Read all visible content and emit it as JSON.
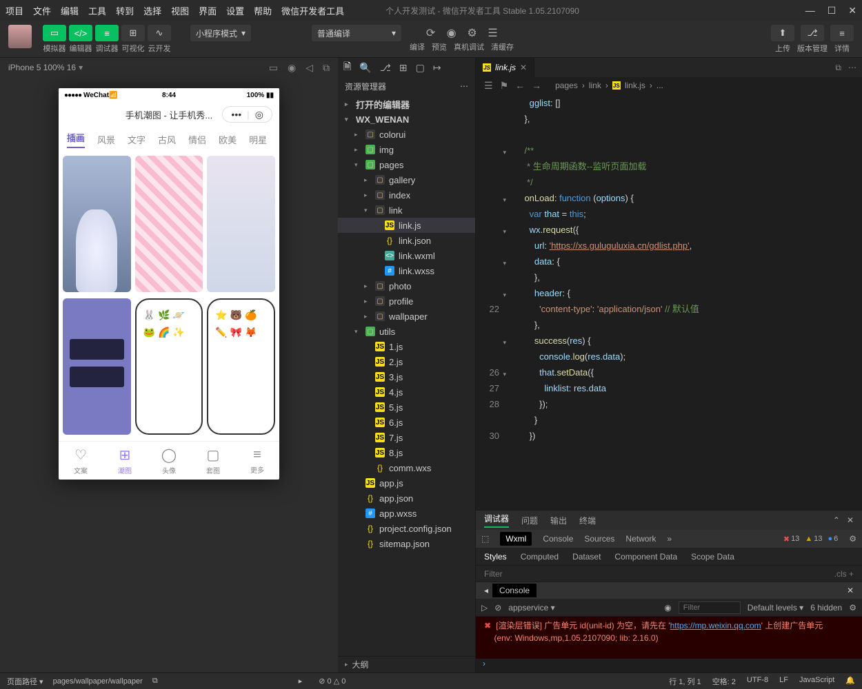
{
  "menu": [
    "项目",
    "文件",
    "编辑",
    "工具",
    "转到",
    "选择",
    "视图",
    "界面",
    "设置",
    "帮助",
    "微信开发者工具"
  ],
  "title": "个人开发测试 - 微信开发者工具 Stable 1.05.2107090",
  "toolbar": {
    "groups": [
      "模拟器",
      "编辑器",
      "调试器",
      "可视化",
      "云开发"
    ],
    "mode_select": "小程序模式",
    "compile_select": "普通编译",
    "center": [
      "编译",
      "预览",
      "真机调试",
      "清缓存"
    ],
    "right": [
      "上传",
      "版本管理",
      "详情"
    ]
  },
  "sim": {
    "device": "iPhone 5 100% 16",
    "wechat": "WeChat",
    "time": "8:44",
    "battery": "100%",
    "app_title": "手机潮图 - 让手机秀...",
    "tabs": [
      "插画",
      "风景",
      "文字",
      "古风",
      "情侣",
      "欧美",
      "明星"
    ],
    "nav": [
      "文案",
      "潮图",
      "头像",
      "套图",
      "更多"
    ]
  },
  "explorer": {
    "title": "资源管理器",
    "open_editors": "打开的编辑器",
    "project": "WX_WENAN",
    "tree": [
      {
        "d": 1,
        "t": "folder",
        "l": "colorui"
      },
      {
        "d": 1,
        "t": "folder-g",
        "l": "img"
      },
      {
        "d": 1,
        "t": "folder-g",
        "l": "pages",
        "open": true
      },
      {
        "d": 2,
        "t": "folder",
        "l": "gallery"
      },
      {
        "d": 2,
        "t": "folder",
        "l": "index"
      },
      {
        "d": 2,
        "t": "folder",
        "l": "link",
        "open": true
      },
      {
        "d": 3,
        "t": "js",
        "l": "link.js",
        "sel": true
      },
      {
        "d": 3,
        "t": "json",
        "l": "link.json"
      },
      {
        "d": 3,
        "t": "wxml",
        "l": "link.wxml"
      },
      {
        "d": 3,
        "t": "wxss",
        "l": "link.wxss"
      },
      {
        "d": 2,
        "t": "folder",
        "l": "photo"
      },
      {
        "d": 2,
        "t": "folder",
        "l": "profile"
      },
      {
        "d": 2,
        "t": "folder",
        "l": "wallpaper"
      },
      {
        "d": 1,
        "t": "folder-g",
        "l": "utils",
        "open": true
      },
      {
        "d": 2,
        "t": "js",
        "l": "1.js"
      },
      {
        "d": 2,
        "t": "js",
        "l": "2.js"
      },
      {
        "d": 2,
        "t": "js",
        "l": "3.js"
      },
      {
        "d": 2,
        "t": "js",
        "l": "4.js"
      },
      {
        "d": 2,
        "t": "js",
        "l": "5.js"
      },
      {
        "d": 2,
        "t": "js",
        "l": "6.js"
      },
      {
        "d": 2,
        "t": "js",
        "l": "7.js"
      },
      {
        "d": 2,
        "t": "js",
        "l": "8.js"
      },
      {
        "d": 2,
        "t": "json",
        "l": "comm.wxs"
      },
      {
        "d": 1,
        "t": "js",
        "l": "app.js"
      },
      {
        "d": 1,
        "t": "json",
        "l": "app.json"
      },
      {
        "d": 1,
        "t": "wxss",
        "l": "app.wxss"
      },
      {
        "d": 1,
        "t": "json",
        "l": "project.config.json"
      },
      {
        "d": 1,
        "t": "json",
        "l": "sitemap.json"
      }
    ],
    "outline": "大纲"
  },
  "editor": {
    "tab": "link.js",
    "crumb": [
      "pages",
      "link",
      "link.js",
      "..."
    ],
    "lines": [
      {
        "n": "",
        "h": "      <span class='v'>gglist</span>: []"
      },
      {
        "n": "",
        "h": "    },"
      },
      {
        "n": "",
        "h": ""
      },
      {
        "n": "",
        "h": "    <span class='c'>/**</span>"
      },
      {
        "n": "",
        "h": "<span class='c'>     * 生命周期函数--监听页面加载</span>"
      },
      {
        "n": "",
        "h": "<span class='c'>     */</span>"
      },
      {
        "n": "",
        "h": "    <span class='f'>onLoad</span>: <span class='k'>function</span> (<span class='v'>options</span>) {"
      },
      {
        "n": "",
        "h": "      <span class='k'>var</span> <span class='v'>that</span> = <span class='k'>this</span>;"
      },
      {
        "n": "",
        "h": "      <span class='v'>wx</span>.<span class='f'>request</span>({"
      },
      {
        "n": "",
        "h": "        <span class='v'>url</span>: <span class='s url'>'https://xs.guluguluxia.cn/gdlist.php'</span>,"
      },
      {
        "n": "",
        "h": "        <span class='v'>data</span>: {"
      },
      {
        "n": "",
        "h": "        },"
      },
      {
        "n": "",
        "h": "        <span class='v'>header</span>: {"
      },
      {
        "n": "22",
        "h": "          <span class='s'>'content-type'</span>: <span class='s'>'application/json'</span> <span class='c'>// 默认值</span>"
      },
      {
        "n": "",
        "h": "        },"
      },
      {
        "n": "",
        "h": "        <span class='f'>success</span>(<span class='v'>res</span>) {"
      },
      {
        "n": "",
        "h": "          <span class='v'>console</span>.<span class='f'>log</span>(<span class='v'>res</span>.<span class='v'>data</span>);"
      },
      {
        "n": "26",
        "h": "          <span class='v'>that</span>.<span class='f'>setData</span>({"
      },
      {
        "n": "27",
        "h": "            <span class='v'>linklist</span>: <span class='v'>res</span>.<span class='v'>data</span>"
      },
      {
        "n": "28",
        "h": "          });"
      },
      {
        "n": "",
        "h": "        }"
      },
      {
        "n": "30",
        "h": "      })"
      }
    ]
  },
  "debugger": {
    "tabs": [
      "调试器",
      "问题",
      "输出",
      "终端"
    ],
    "subtabs": [
      "Wxml",
      "Console",
      "Sources",
      "Network"
    ],
    "badges": {
      "err": "13",
      "wrn": "13",
      "inf": "6"
    },
    "styles_tabs": [
      "Styles",
      "Computed",
      "Dataset",
      "Component Data",
      "Scope Data"
    ],
    "filter": "Filter",
    "cls": ".cls",
    "console": "Console",
    "context": "appservice",
    "filter2": "Filter",
    "levels": "Default levels",
    "hidden": "6 hidden",
    "err_line1_a": "[渲染层错误] 广告单元 id(unit-id) 为空，请先在 '",
    "err_url": "https://mp.weixin.qq.com",
    "err_line1_b": "' 上创建广告单元",
    "err_line2": "(env: Windows,mp,1.05.2107090; lib: 2.16.0)"
  },
  "status": {
    "left_label": "页面路径",
    "path": "pages/wallpaper/wallpaper",
    "warn0": "0",
    "warn1": "0",
    "right": [
      "行 1, 列 1",
      "空格: 2",
      "UTF-8",
      "LF",
      "JavaScript"
    ]
  }
}
